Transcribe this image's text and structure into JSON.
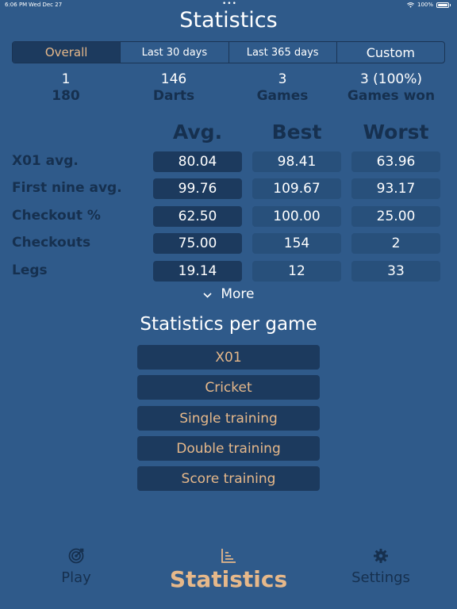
{
  "status_bar": {
    "time": "6:06 PM",
    "date": "Wed Dec 27",
    "battery": "100%"
  },
  "title": "Statistics",
  "period_tabs": [
    {
      "label": "Overall",
      "selected": true
    },
    {
      "label": "Last 30 days",
      "selected": false
    },
    {
      "label": "Last 365 days",
      "selected": false
    },
    {
      "label": "Custom",
      "selected": false
    }
  ],
  "summary": [
    {
      "value": "1",
      "label": "180"
    },
    {
      "value": "146",
      "label": "Darts"
    },
    {
      "value": "3",
      "label": "Games"
    },
    {
      "value": "3 (100%)",
      "label": "Games won"
    }
  ],
  "table": {
    "headers": [
      "Avg.",
      "Best",
      "Worst"
    ],
    "rows": [
      {
        "label": "X01 avg.",
        "avg": "80.04",
        "best": "98.41",
        "worst": "63.96"
      },
      {
        "label": "First nine avg.",
        "avg": "99.76",
        "best": "109.67",
        "worst": "93.17"
      },
      {
        "label": "Checkout %",
        "avg": "62.50",
        "best": "100.00",
        "worst": "25.00"
      },
      {
        "label": "Checkouts",
        "avg": "75.00",
        "best": "154",
        "worst": "2"
      },
      {
        "label": "Legs",
        "avg": "19.14",
        "best": "12",
        "worst": "33"
      }
    ]
  },
  "more_label": "More",
  "per_game": {
    "title": "Statistics per game",
    "buttons": [
      "X01",
      "Cricket",
      "Single training",
      "Double training",
      "Score training"
    ]
  },
  "tabbar": [
    {
      "label": "Play",
      "icon": "target-icon",
      "active": false
    },
    {
      "label": "Statistics",
      "icon": "chart-icon",
      "active": true
    },
    {
      "label": "Settings",
      "icon": "gear-icon",
      "active": false
    }
  ],
  "colors": {
    "background": "#2f5a8a",
    "dark_cell": "#1c3a5e",
    "accent": "#e6b88a",
    "label_dark": "#16304f"
  }
}
